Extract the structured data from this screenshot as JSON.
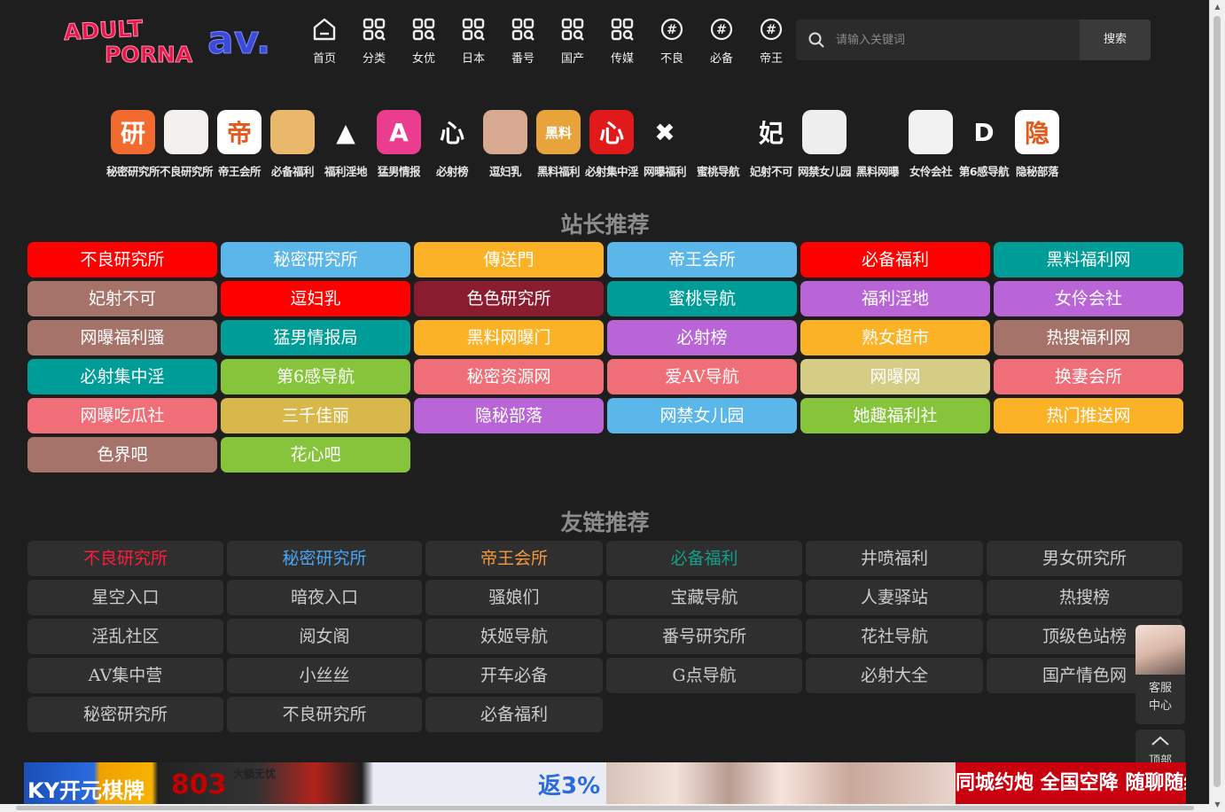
{
  "header": {
    "logo_text": "ADULT PORNA AV.",
    "search_placeholder": "请输入关键词",
    "search_button": "搜索",
    "nav": [
      {
        "label": "首页",
        "icon": "home-icon"
      },
      {
        "label": "分类",
        "icon": "grid-search-icon"
      },
      {
        "label": "女优",
        "icon": "grid-search-icon"
      },
      {
        "label": "日本",
        "icon": "grid-search-icon"
      },
      {
        "label": "番号",
        "icon": "grid-search-icon"
      },
      {
        "label": "国产",
        "icon": "grid-search-icon"
      },
      {
        "label": "传媒",
        "icon": "grid-search-icon"
      },
      {
        "label": "不良",
        "icon": "hashtag-icon"
      },
      {
        "label": "必备",
        "icon": "hashtag-icon"
      },
      {
        "label": "帝王",
        "icon": "hashtag-icon"
      }
    ]
  },
  "apps": [
    {
      "label": "秘密研究所",
      "glyph": "研",
      "bg": "#f16a2e"
    },
    {
      "label": "不良研究所",
      "glyph": "",
      "bg": "#f4f0ee"
    },
    {
      "label": "帝王会所",
      "glyph": "帝",
      "bg": "#ffffff"
    },
    {
      "label": "必备福利",
      "glyph": "",
      "bg": "#e9b86a"
    },
    {
      "label": "福利淫地",
      "glyph": "▲",
      "bg": "#1e1e1e"
    },
    {
      "label": "猛男情报",
      "glyph": "A",
      "bg": "#ea3d8f"
    },
    {
      "label": "必射榜",
      "glyph": "心",
      "bg": "#1e1e1e"
    },
    {
      "label": "逗妇乳",
      "glyph": "",
      "bg": "#d7a990"
    },
    {
      "label": "黑料福利",
      "glyph": "黑料",
      "bg": "#e8a33a"
    },
    {
      "label": "必射集中淫",
      "glyph": "心",
      "bg": "#e01a1a"
    },
    {
      "label": "网曝福利",
      "glyph": "✖",
      "bg": "#1e1e1e"
    },
    {
      "label": "蜜桃导航",
      "glyph": "",
      "bg": "#1e1e1e"
    },
    {
      "label": "妃射不可",
      "glyph": "妃",
      "bg": "#1e1e1e"
    },
    {
      "label": "网禁女儿园",
      "glyph": "",
      "bg": "#eeeeee"
    },
    {
      "label": "黑料网曝",
      "glyph": "",
      "bg": "#1e1e1e"
    },
    {
      "label": "女伶会社",
      "glyph": "",
      "bg": "#f2f2f2"
    },
    {
      "label": "第6感导航",
      "glyph": "D",
      "bg": "#1e1e1e"
    },
    {
      "label": "隐秘部落",
      "glyph": "隐",
      "bg": "#ffffff"
    }
  ],
  "station_title": "站长推荐",
  "station": [
    {
      "label": "不良研究所",
      "color": "#fe0000"
    },
    {
      "label": "秘密研究所",
      "color": "#5bb6ea"
    },
    {
      "label": "傳送門",
      "color": "#fbb226"
    },
    {
      "label": "帝王会所",
      "color": "#5bb6ea"
    },
    {
      "label": "必备福利",
      "color": "#fe0000"
    },
    {
      "label": "黑料福利网",
      "color": "#009c98"
    },
    {
      "label": "妃射不可",
      "color": "#a6736b"
    },
    {
      "label": "逗妇乳",
      "color": "#fe0000"
    },
    {
      "label": "色色研究所",
      "color": "#8a1c30"
    },
    {
      "label": "蜜桃导航",
      "color": "#009c98"
    },
    {
      "label": "福利淫地",
      "color": "#b965d8"
    },
    {
      "label": "女伶会社",
      "color": "#b965d8"
    },
    {
      "label": "网曝福利骚",
      "color": "#a6736b"
    },
    {
      "label": "猛男情报局",
      "color": "#009c98"
    },
    {
      "label": "黑料网曝门",
      "color": "#fbb226"
    },
    {
      "label": "必射榜",
      "color": "#b965d8"
    },
    {
      "label": "熟女超市",
      "color": "#fbb226"
    },
    {
      "label": "热搜福利网",
      "color": "#a6736b"
    },
    {
      "label": "必射集中淫",
      "color": "#009c98"
    },
    {
      "label": "第6感导航",
      "color": "#86c43c"
    },
    {
      "label": "秘密资源网",
      "color": "#ef6e77"
    },
    {
      "label": "爱AV导航",
      "color": "#ef6e77"
    },
    {
      "label": "网曝网",
      "color": "#d5cc86"
    },
    {
      "label": "换妻会所",
      "color": "#ef6e77"
    },
    {
      "label": "网曝吃瓜社",
      "color": "#ef6e77"
    },
    {
      "label": "三千佳丽",
      "color": "#d8b84a"
    },
    {
      "label": "隐秘部落",
      "color": "#b965d8"
    },
    {
      "label": "网禁女儿园",
      "color": "#5bb6ea"
    },
    {
      "label": "她趣福利社",
      "color": "#86c43c"
    },
    {
      "label": "热门推送网",
      "color": "#fbb226"
    },
    {
      "label": "色界吧",
      "color": "#a6736b"
    },
    {
      "label": "花心吧",
      "color": "#86c43c"
    }
  ],
  "friends_title": "友链推荐",
  "friends": [
    {
      "label": "不良研究所",
      "color": "#ff1d3b"
    },
    {
      "label": "秘密研究所",
      "color": "#4aa6f5"
    },
    {
      "label": "帝王会所",
      "color": "#f39a3c"
    },
    {
      "label": "必备福利",
      "color": "#12a08a"
    },
    {
      "label": "井喷福利",
      "color": "#cccccc"
    },
    {
      "label": "男女研究所",
      "color": "#cccccc"
    },
    {
      "label": "星空入口",
      "color": "#cccccc"
    },
    {
      "label": "暗夜入口",
      "color": "#cccccc"
    },
    {
      "label": "骚娘们",
      "color": "#cccccc"
    },
    {
      "label": "宝藏导航",
      "color": "#cccccc"
    },
    {
      "label": "人妻驿站",
      "color": "#cccccc"
    },
    {
      "label": "热搜榜",
      "color": "#cccccc"
    },
    {
      "label": "淫乱社区",
      "color": "#cccccc"
    },
    {
      "label": "阅女阁",
      "color": "#cccccc"
    },
    {
      "label": "妖姬导航",
      "color": "#cccccc"
    },
    {
      "label": "番号研究所",
      "color": "#cccccc"
    },
    {
      "label": "花社导航",
      "color": "#cccccc"
    },
    {
      "label": "顶级色站榜",
      "color": "#cccccc"
    },
    {
      "label": "AV集中营",
      "color": "#cccccc"
    },
    {
      "label": "小丝丝",
      "color": "#cccccc"
    },
    {
      "label": "开车必备",
      "color": "#cccccc"
    },
    {
      "label": "G点导航",
      "color": "#cccccc"
    },
    {
      "label": "必射大全",
      "color": "#cccccc"
    },
    {
      "label": "国产情色网",
      "color": "#cccccc"
    },
    {
      "label": "秘密研究所",
      "color": "#cccccc"
    },
    {
      "label": "不良研究所",
      "color": "#cccccc"
    },
    {
      "label": "必备福利",
      "color": "#cccccc"
    }
  ],
  "float": {
    "service_line1": "客服",
    "service_line2": "中心",
    "top_label": "顶部"
  },
  "banner": {
    "left_t1": "KY开元棋牌",
    "left_t2": "803",
    "left_t3": "大额无忧",
    "left_t4": "返3%",
    "right_text": "同城约炮 全国空降 随聊随约"
  }
}
